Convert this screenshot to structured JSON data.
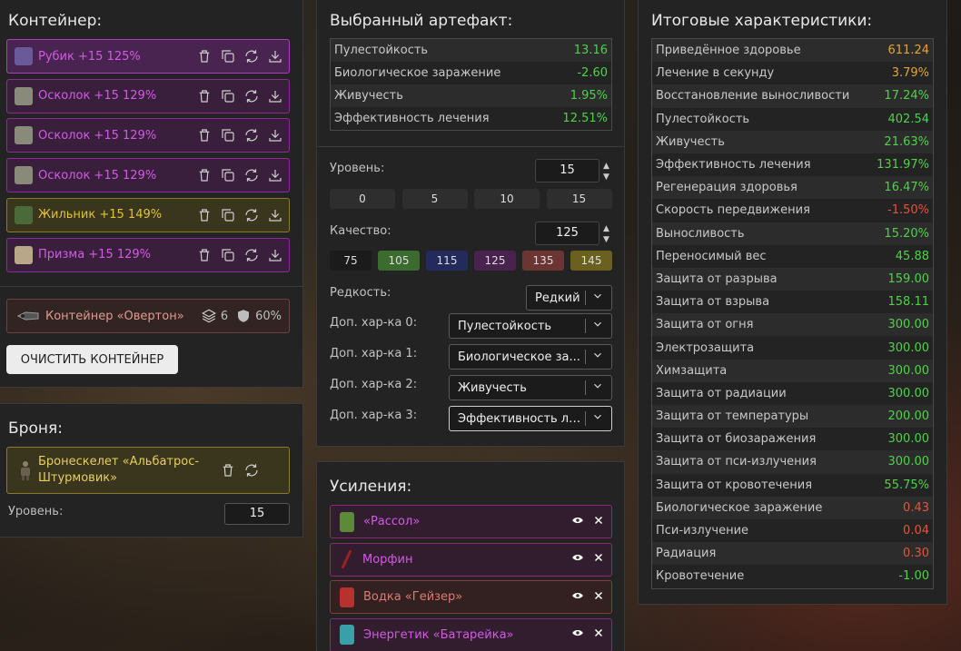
{
  "container": {
    "title": "Контейнер:",
    "slots": [
      {
        "label": "Рубик +15 125%",
        "color": "purple",
        "icon": "rubik-artifact-icon"
      },
      {
        "label": "Осколок +15 129%",
        "color": "purple",
        "icon": "shard-artifact-icon"
      },
      {
        "label": "Осколок +15 129%",
        "color": "purple",
        "icon": "shard-artifact-icon"
      },
      {
        "label": "Осколок +15 129%",
        "color": "purple",
        "icon": "shard-artifact-icon"
      },
      {
        "label": "Жильник +15 149%",
        "color": "gold",
        "icon": "vein-artifact-icon"
      },
      {
        "label": "Призма +15 129%",
        "color": "purple",
        "icon": "prism-artifact-icon"
      }
    ],
    "box": {
      "label": "Контейнер «Овертон»",
      "slots": "6",
      "protection": "60%"
    },
    "clear_button": "ОЧИСТИТЬ КОНТЕЙНЕР"
  },
  "armor": {
    "title": "Броня:",
    "name": "Бронескелет «Альбатрос-Штурмовик»",
    "level_label": "Уровень:",
    "level": "15"
  },
  "artifact": {
    "title": "Выбранный артефакт:",
    "stats": [
      {
        "name": "Пулестойкость",
        "value": "13.16",
        "tone": "green"
      },
      {
        "name": "Биологическое заражение",
        "value": "-2.60",
        "tone": "green"
      },
      {
        "name": "Живучесть",
        "value": "1.95%",
        "tone": "green"
      },
      {
        "name": "Эффективность лечения",
        "value": "12.51%",
        "tone": "green"
      }
    ],
    "level_label": "Уровень:",
    "level": "15",
    "level_presets": [
      "0",
      "5",
      "10",
      "15"
    ],
    "quality_label": "Качество:",
    "quality": "125",
    "quality_presets": [
      {
        "label": "75",
        "color": "#1b1b1b"
      },
      {
        "label": "105",
        "color": "#3b6b2f"
      },
      {
        "label": "115",
        "color": "#232a5c"
      },
      {
        "label": "125",
        "color": "#4a2250"
      },
      {
        "label": "135",
        "color": "#6a3532"
      },
      {
        "label": "145",
        "color": "#6a6020"
      }
    ],
    "rarity_label": "Редкость:",
    "rarity": "Редкий",
    "extra": [
      {
        "label": "Доп. хар-ка 0:",
        "value": "Пулестойкость"
      },
      {
        "label": "Доп. хар-ка 1:",
        "value": "Биологическое за..."
      },
      {
        "label": "Доп. хар-ка 2:",
        "value": "Живучесть"
      },
      {
        "label": "Доп. хар-ка 3:",
        "value": "Эффективность ле..."
      }
    ]
  },
  "boosts": {
    "title": "Усиления:",
    "items": [
      {
        "label": "«Рассол»",
        "style": "purple",
        "icon": "jar-icon",
        "icon_color": "#5c8a3a"
      },
      {
        "label": "Морфин",
        "style": "purple",
        "icon": "syringe-icon",
        "icon_color": "#a02020"
      },
      {
        "label": "Водка «Гейзер»",
        "style": "red",
        "icon": "bottle-icon",
        "icon_color": "#b83030"
      },
      {
        "label": "Энергетик «Батарейка»",
        "style": "purple",
        "icon": "can-icon",
        "icon_color": "#3aa0a8"
      }
    ]
  },
  "totals": {
    "title": "Итоговые характеристики:",
    "stats": [
      {
        "name": "Приведённое здоровье",
        "value": "611.24",
        "tone": "orange"
      },
      {
        "name": "Лечение в секунду",
        "value": "3.79%",
        "tone": "orange"
      },
      {
        "name": "Восстановление выносливости",
        "value": "17.24%",
        "tone": "green"
      },
      {
        "name": "Пулестойкость",
        "value": "402.54",
        "tone": "green"
      },
      {
        "name": "Живучесть",
        "value": "21.63%",
        "tone": "green"
      },
      {
        "name": "Эффективность лечения",
        "value": "131.97%",
        "tone": "green"
      },
      {
        "name": "Регенерация здоровья",
        "value": "16.47%",
        "tone": "green"
      },
      {
        "name": "Скорость передвижения",
        "value": "-1.50%",
        "tone": "red"
      },
      {
        "name": "Выносливость",
        "value": "15.20%",
        "tone": "green"
      },
      {
        "name": "Переносимый вес",
        "value": "45.88",
        "tone": "green"
      },
      {
        "name": "Защита от разрыва",
        "value": "159.00",
        "tone": "green"
      },
      {
        "name": "Защита от взрыва",
        "value": "158.11",
        "tone": "green"
      },
      {
        "name": "Защита от огня",
        "value": "300.00",
        "tone": "green"
      },
      {
        "name": "Электрозащита",
        "value": "300.00",
        "tone": "green"
      },
      {
        "name": "Химзащита",
        "value": "300.00",
        "tone": "green"
      },
      {
        "name": "Защита от радиации",
        "value": "300.00",
        "tone": "green"
      },
      {
        "name": "Защита от температуры",
        "value": "200.00",
        "tone": "green"
      },
      {
        "name": "Защита от биозаражения",
        "value": "300.00",
        "tone": "green"
      },
      {
        "name": "Защита от пси-излучения",
        "value": "300.00",
        "tone": "green"
      },
      {
        "name": "Защита от кровотечения",
        "value": "55.75%",
        "tone": "green"
      },
      {
        "name": "Биологическое заражение",
        "value": "0.43",
        "tone": "red"
      },
      {
        "name": "Пси-излучение",
        "value": "0.04",
        "tone": "red"
      },
      {
        "name": "Радиация",
        "value": "0.30",
        "tone": "red"
      },
      {
        "name": "Кровотечение",
        "value": "-1.00",
        "tone": "green"
      }
    ]
  }
}
